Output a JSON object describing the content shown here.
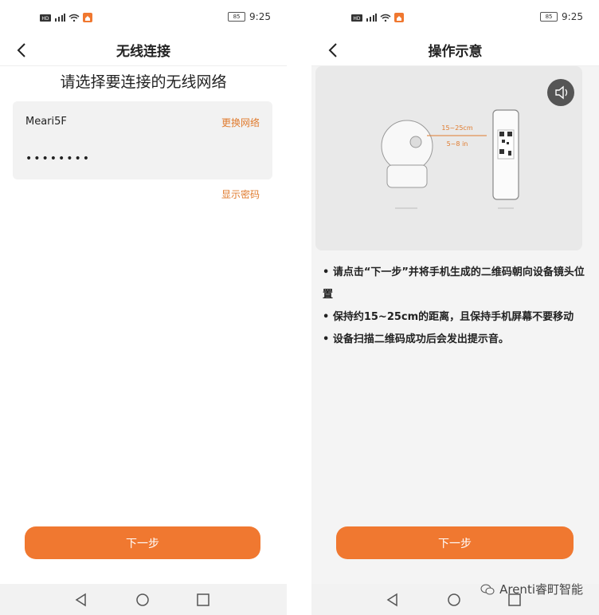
{
  "left_screen": {
    "status": {
      "time": "9:25",
      "battery": "85",
      "hd_label": "HD"
    },
    "nav": {
      "title": "无线连接"
    },
    "heading": "请选择要连接的无线网络",
    "wifi": {
      "ssid": "Meari5F",
      "change_network": "更换网络",
      "password_masked": "••••••••",
      "show_password": "显示密码"
    },
    "next_button": "下一步"
  },
  "right_screen": {
    "status": {
      "time": "9:25",
      "battery": "85",
      "hd_label": "HD"
    },
    "nav": {
      "title": "操作示意"
    },
    "illustration": {
      "distance_cm": "15~25cm",
      "distance_in": "5~8 in"
    },
    "instructions": [
      "• 请点击“下一步”并将手机生成的二维码朝向设备镜头位置",
      "• 保持约15~25cm的距离，且保持手机屏幕不要移动",
      "• 设备扫描二维码成功后会发出提示音。"
    ],
    "next_button": "下一步"
  },
  "watermark": "Arenti睿町智能",
  "colors": {
    "accent": "#f07830",
    "link": "#e07b2e"
  }
}
